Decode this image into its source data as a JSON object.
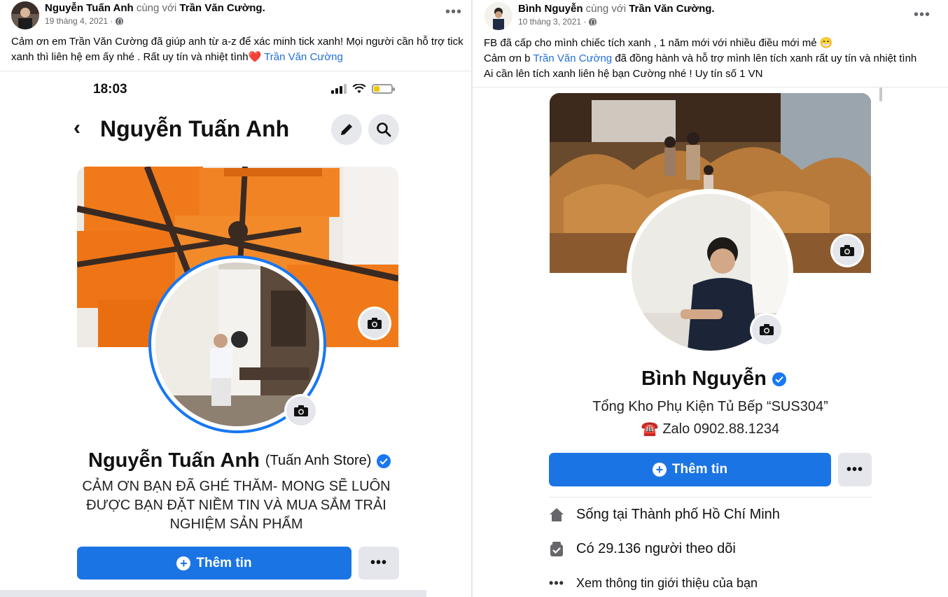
{
  "left_post": {
    "author": "Nguyễn Tuấn Anh",
    "with_word": "cùng với",
    "tagged": "Trần Văn Cường.",
    "date": "19 tháng 4, 2021 ·",
    "caption_line1": "Cảm ơn em Trần Văn Cường đã giúp anh từ a-z để xác minh tick xanh! Mọi người cần hỗ trợ tick",
    "caption_line2": "xanh thì liên hệ em ấy nhé . Rất uy tín và nhiệt tình",
    "caption_link": " Trần Văn Cường",
    "more": "•••",
    "screenshot": {
      "time": "18:03",
      "nav_title": "Nguyễn Tuấn Anh",
      "back": "‹",
      "profile_name": "Nguyễn Tuấn Anh",
      "profile_sub": "(Tuấn Anh Store)",
      "bio_line1": "CẢM ƠN BẠN ĐÃ GHÉ THĂM- MONG SẼ LUÔN",
      "bio_line2": "ĐƯỢC BẠN ĐẶT NIỀM TIN VÀ MUA SẮM TRẢI",
      "bio_line3": "NGHIỆM SẢN PHẨM",
      "primary_button": "Thêm tin",
      "more_button": "•••"
    }
  },
  "right_post": {
    "author": "Bình Nguyễn",
    "with_word": "cùng với",
    "tagged": "Trần Văn Cường.",
    "date": "10 tháng 3, 2021 ·",
    "caption_line1": "FB đã cấp cho mình chiếc tích xanh , 1 năm mới với nhiều điều mới mẻ 😁",
    "caption_line2_pre": "Cảm ơn b ",
    "caption_link": "Trần Văn Cường",
    "caption_line2_post": " đã đồng hành và hỗ trợ mình lên tích xanh rất uy tín và nhiệt tình",
    "caption_line3": "Ai cần lên tích xanh liên hệ bạn Cường nhé ! Uy tín số 1 VN",
    "more": "•••",
    "screenshot": {
      "profile_name": "Bình Nguyễn",
      "bio_line1": "Tổng Kho Phụ Kiện Tủ Bếp “SUS304”",
      "bio_line2": "☎️ Zalo 0902.88.1234",
      "primary_button": "Thêm tin",
      "more_button": "•••",
      "info_lives": "Sống tại Thành phố Hồ Chí Minh",
      "info_followers": "Có 29.136 người theo dõi",
      "info_about": "Xem thông tin giới thiệu của bạn"
    }
  },
  "colors": {
    "facebook_blue": "#1b74e4",
    "link_blue": "#216fdb",
    "verified_blue": "#1877f2",
    "cover_orange": "#f07a1a"
  }
}
